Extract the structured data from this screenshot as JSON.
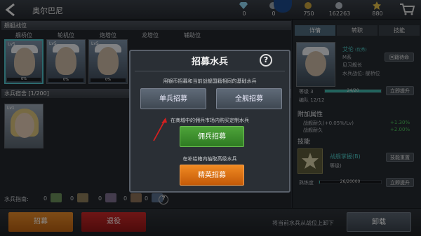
{
  "topbar": {
    "title": "奥尔巴尼",
    "resources": [
      {
        "icon": "diamond-icon",
        "value": "0"
      },
      {
        "icon": "medal-icon",
        "value": "0"
      },
      {
        "icon": "gold-coin-icon",
        "value": "750"
      },
      {
        "icon": "silver-coin-icon",
        "value": "162263"
      },
      {
        "icon": "star-icon",
        "value": "880"
      }
    ]
  },
  "left": {
    "section_title": "舰艇战位",
    "slot_labels": [
      "舰桥位",
      "轮机位",
      "炮塔位",
      "龙塔位",
      "辅助位"
    ],
    "slots": [
      {
        "level": "Lv5",
        "percent": "0%"
      },
      {
        "level": "Lv5",
        "percent": "0%"
      },
      {
        "level": "Lv5",
        "percent": "0%"
      }
    ],
    "dorm_title": "水兵宿舍",
    "dorm_count": "[1/200]",
    "card_level": "Lv1",
    "guide_label": "水兵指南:",
    "guide_items": [
      "0",
      "0",
      "0",
      "0",
      "0"
    ]
  },
  "modal": {
    "title": "招募水兵",
    "help": "?",
    "text1": "用银币招募和当前战舰国籍相同的基础水兵",
    "single_btn": "单兵招募",
    "full_btn": "全舰招募",
    "text2": "在商城中的佣兵市场内购买定制水兵",
    "merc_btn": "佣兵招募",
    "text3": "在补给箱内抽取高级水兵",
    "elite_btn": "精英招募"
  },
  "right": {
    "tabs": [
      "详情",
      "转职",
      "技能"
    ],
    "name": "艾伦",
    "rarity": "(优秀)",
    "nation": "M系",
    "rank": "见习舰长",
    "position_label": "水兵战位:",
    "position": "舰桥位",
    "return_btn": "回籍待命",
    "level_label": "等级",
    "level": "3",
    "exp": "24/20",
    "upgrade_btn": "立即提升",
    "crew_label": "编队",
    "crew": "12/12",
    "attr_title": "附加属性",
    "attr1_label": "战舰耐久(+0.05%/Lv)",
    "attr1_value": "+1.30%",
    "attr2_label": "战舰耐久",
    "attr2_value": "+2.00%",
    "skill_title": "技能",
    "skill_name": "战舰掌握(B)",
    "skill_level": "等级)",
    "skill_btn": "技能重置",
    "prof_label": "熟练度",
    "prof_value": "26/20000",
    "prof_btn": "立即提升"
  },
  "bottom": {
    "recruit_btn": "招募",
    "retire_btn": "退役",
    "hint": "将当前水兵从战位上卸下",
    "unload_btn": "卸载"
  },
  "colors": {
    "accent": "#3fb5aa",
    "recruit": "#d9781b",
    "retire": "#b21c1c",
    "green": "#3c8f2b",
    "orange": "#e2700e"
  }
}
